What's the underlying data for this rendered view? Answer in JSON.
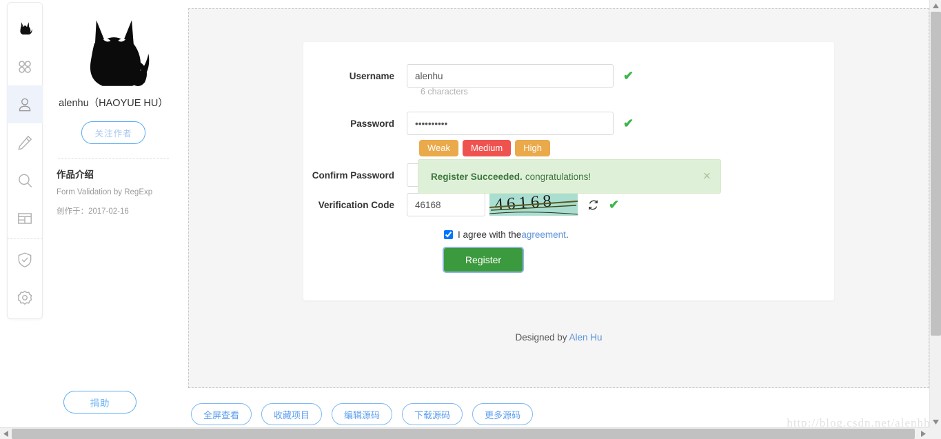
{
  "sidebar": {
    "items": [
      {
        "name": "logo",
        "icon": "cat-logo-icon",
        "active": false
      },
      {
        "name": "apps",
        "icon": "grid-apps-icon",
        "active": false
      },
      {
        "name": "user",
        "icon": "user-icon",
        "active": true
      },
      {
        "name": "edit",
        "icon": "pencil-icon",
        "active": false
      },
      {
        "name": "search",
        "icon": "search-icon",
        "active": false
      },
      {
        "name": "layout",
        "icon": "layout-table-icon",
        "active": false
      },
      {
        "name": "shield",
        "icon": "shield-check-icon",
        "active": false
      },
      {
        "name": "settings",
        "icon": "gear-icon",
        "active": false
      }
    ]
  },
  "profile": {
    "avatar_icon": "cat-avatar-icon",
    "name": "alenhu（HAOYUE HU）",
    "follow_label": "关注作者",
    "section_title": "作品介绍",
    "description": "Form Validation by RegExp",
    "created_label": "创作于：2017-02-16",
    "donate_label": "捐助"
  },
  "form": {
    "username": {
      "label": "Username",
      "value": "alenhu",
      "placeholder": "",
      "hint": "6 characters",
      "valid_icon": "check-icon"
    },
    "password": {
      "label": "Password",
      "value": "••••••••••",
      "placeholder": "",
      "valid_icon": "check-icon",
      "strength": [
        {
          "label": "Weak",
          "color": "#eaa94a"
        },
        {
          "label": "Medium",
          "color": "#ef5350"
        },
        {
          "label": "High",
          "color": "#eaa94a"
        }
      ]
    },
    "confirm_password": {
      "label": "Confirm Password"
    },
    "verification": {
      "label": "Verification Code",
      "value": "46168",
      "captcha_text": "46168",
      "captcha_bg": "#a9ded0",
      "refresh_icon": "refresh-icon",
      "valid_icon": "check-icon"
    },
    "agreement": {
      "checked": true,
      "text": "I agree with the ",
      "link_text": "agreement",
      "trailing": "."
    },
    "submit_label": "Register"
  },
  "alert": {
    "strong": "Register Succeeded.",
    "message": " congratulations!",
    "close_icon": "close-icon",
    "bg": "#dff0d8",
    "text_color": "#3c763d"
  },
  "footer": {
    "designed_prefix": "Designed by ",
    "designed_link": "Alen Hu"
  },
  "actions": {
    "buttons": [
      {
        "label": "全屏查看"
      },
      {
        "label": "收藏项目"
      },
      {
        "label": "编辑源码"
      },
      {
        "label": "下载源码"
      },
      {
        "label": "更多源码"
      }
    ]
  },
  "watermark": "http://blog.csdn.net/alenhhy"
}
